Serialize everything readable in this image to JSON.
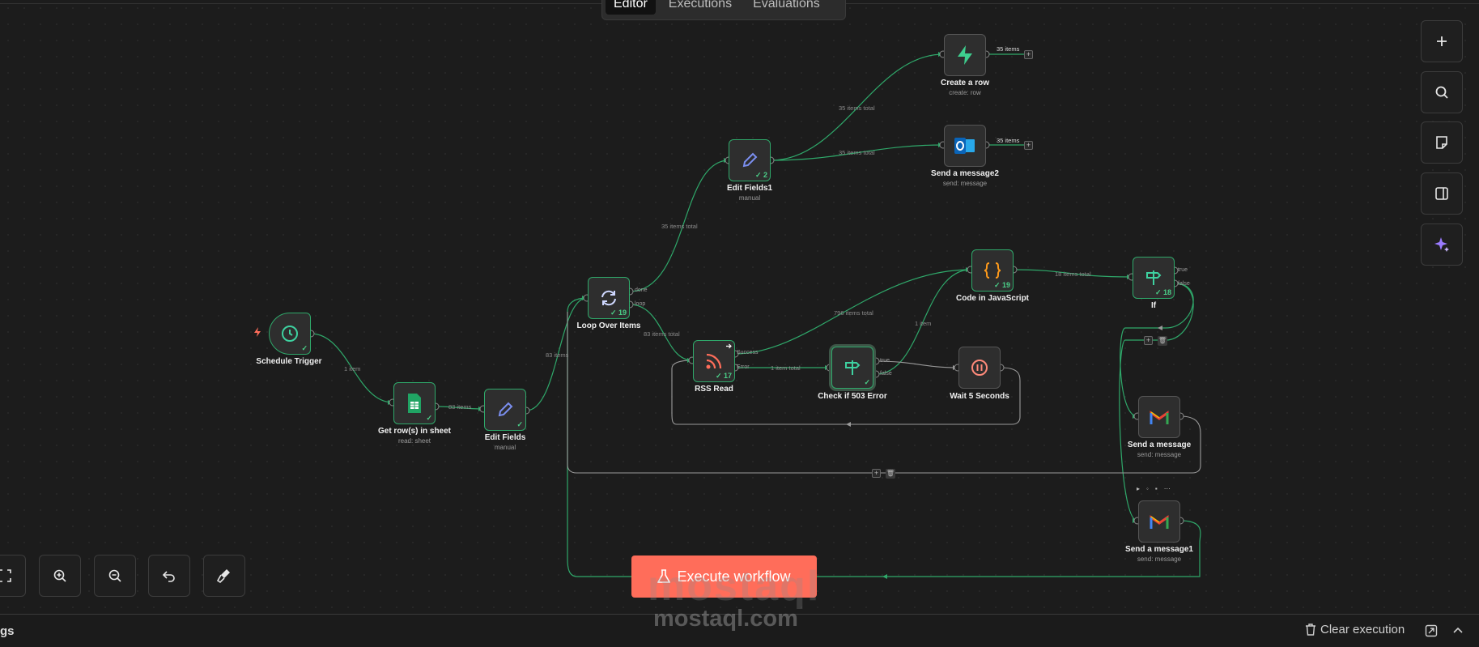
{
  "tabs": {
    "editor": "Editor",
    "executions": "Executions",
    "evaluations": "Evaluations"
  },
  "nodes": {
    "schedule": {
      "label": "Schedule Trigger"
    },
    "getrows": {
      "label": "Get row(s) in sheet",
      "sub": "read: sheet"
    },
    "editfields": {
      "label": "Edit Fields",
      "sub": "manual"
    },
    "loop": {
      "label": "Loop Over Items",
      "badge": "19",
      "port_done": "done",
      "port_loop": "loop"
    },
    "editfields1": {
      "label": "Edit Fields1",
      "sub": "manual",
      "badge": "2"
    },
    "createrow": {
      "label": "Create a row",
      "sub": "create: row"
    },
    "sendmsg2": {
      "label": "Send a message2",
      "sub": "send: message"
    },
    "rss": {
      "label": "RSS Read",
      "badge": "17",
      "port_success": "Success",
      "port_error": "Error"
    },
    "check503": {
      "label": "Check if 503 Error",
      "port_true": "true",
      "port_false": "false"
    },
    "wait": {
      "label": "Wait 5 Seconds"
    },
    "code": {
      "label": "Code in JavaScript",
      "badge": "19"
    },
    "if": {
      "label": "If",
      "badge": "18",
      "port_true": "true",
      "port_false": "false"
    },
    "sendmsg": {
      "label": "Send a message",
      "sub": "send: message"
    },
    "sendmsg1": {
      "label": "Send a message1",
      "sub": "send: message"
    }
  },
  "wire_labels": {
    "trigger_to_sheet": "1 item",
    "sheet_to_edit": "83 items",
    "edit_to_loop": "83 items",
    "loop_done": "35 items total",
    "loop_loop": "83 items total",
    "edit1_to_create": "35 items total",
    "edit1_to_send2": "35 items total",
    "create_out": "35 items",
    "send2_out": "35 items",
    "rss_to_code": "796 items total",
    "rss_error": "1 item total",
    "check_false": "1 item",
    "code_to_if": "18 items total"
  },
  "buttons": {
    "execute": "Execute workflow",
    "clear_execution": "Clear execution",
    "logs": "gs"
  },
  "icons": {
    "right_toolbar": [
      "plus-icon",
      "search-icon",
      "sticky-note-icon",
      "panel-icon",
      "ai-sparkle-icon"
    ],
    "bottom_toolbar": [
      "fit-view-icon",
      "zoom-in-icon",
      "zoom-out-icon",
      "undo-icon",
      "tidy-up-icon"
    ]
  },
  "colors": {
    "success": "#2fa86a",
    "accent": "#ff6d5a",
    "canvas": "#1c1c1c"
  },
  "watermark": {
    "logo": "mostaql",
    "domain": "mostaql.com"
  }
}
